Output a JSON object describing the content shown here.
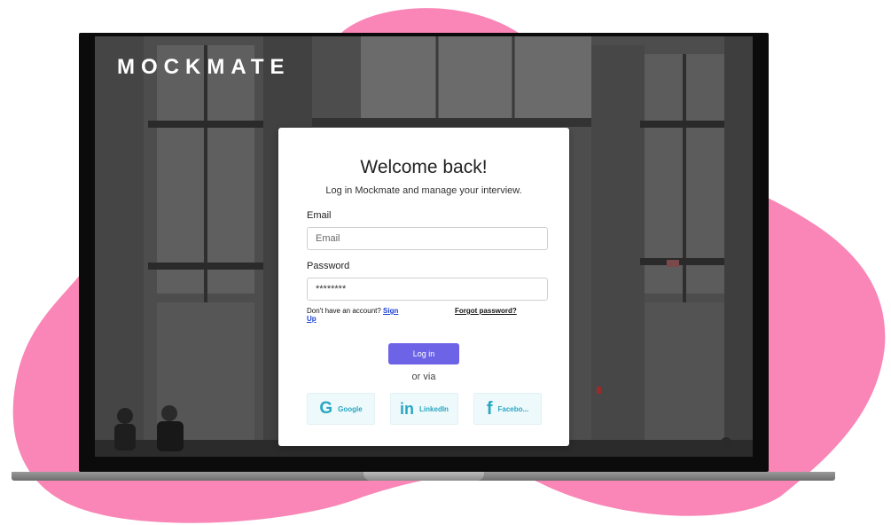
{
  "brand": {
    "name": "MOCKMATE"
  },
  "login": {
    "title": "Welcome back!",
    "subtitle": "Log in Mockmate and manage your interview.",
    "email_label": "Email",
    "email_placeholder": "Email",
    "password_label": "Password",
    "password_value": "********",
    "no_account_text": "Don't have an account? ",
    "signup_link_part1": "Sign",
    "signup_link_part2": "Up",
    "forgot_password": "Forgot password?",
    "login_button": "Log in",
    "or_via": "or via",
    "social": [
      {
        "icon": "google-icon",
        "glyph": "G",
        "label": "Google"
      },
      {
        "icon": "linkedin-icon",
        "glyph": "in",
        "label": "LinkedIn"
      },
      {
        "icon": "facebook-icon",
        "glyph": "f",
        "label": "Facebo..."
      }
    ]
  },
  "colors": {
    "blob": "#f986b6",
    "accent": "#6c63e6",
    "social_text": "#28a7c2",
    "link": "#1a3fd6"
  }
}
